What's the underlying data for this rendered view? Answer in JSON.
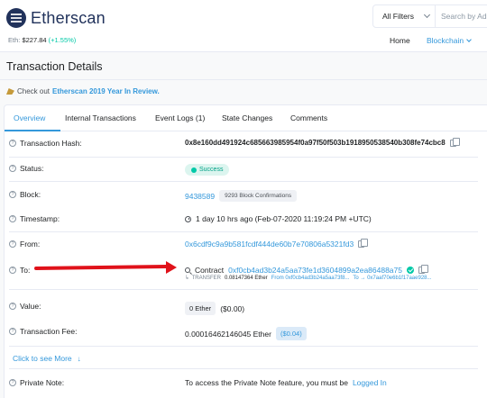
{
  "header": {
    "logo_text": "Etherscan",
    "eth_label": "Eth:",
    "eth_price": "$227.84",
    "eth_change": "(+1.55%)",
    "filter_label": "All Filters",
    "search_placeholder": "Search by Ad",
    "nav_home": "Home",
    "nav_blockchain": "Blockchain"
  },
  "page": {
    "title": "Transaction Details",
    "sponsor_prefix": "Check out",
    "sponsor_link": "Etherscan 2019 Year In Review."
  },
  "tabs": [
    "Overview",
    "Internal Transactions",
    "Event Logs (1)",
    "State Changes",
    "Comments"
  ],
  "rows": {
    "tx_hash": {
      "label": "Transaction Hash:",
      "value": "0x8e160dd491924c685663985954f0a97f50f503b1918950538540b308fe74cbc8"
    },
    "status": {
      "label": "Status:",
      "value": "Success"
    },
    "block": {
      "label": "Block:",
      "value": "9438589",
      "confirmations": "9293 Block Confirmations"
    },
    "timestamp": {
      "label": "Timestamp:",
      "value": "1 day 10 hrs ago (Feb-07-2020 11:19:24 PM +UTC)"
    },
    "from": {
      "label": "From:",
      "value": "0x6cdf9c9a9b581fcdf444de60b7e70806a5321fd3"
    },
    "to": {
      "label": "To:",
      "prefix": "Contract",
      "value": "0xf0cb4ad3b24a5aa73fe1d3604899a2ea86488a75"
    },
    "transfer": {
      "label": "TRANSFER",
      "amount": "0.08147364 Ether",
      "from_text": "From 0xf0cb4ad3b24a5aa73f8...",
      "to_text": "To → 0x7aaf70e6b1f17aae928..."
    },
    "value": {
      "label": "Value:",
      "amount": "0 Ether",
      "usd": "($0.00)"
    },
    "fee": {
      "label": "Transaction Fee:",
      "amount": "0.00016462146045 Ether",
      "usd": "($0.04)"
    },
    "see_more": "Click to see More",
    "note": {
      "label": "Private Note:",
      "text": "To access the Private Note feature, you must be",
      "link": "Logged In"
    }
  },
  "colors": {
    "accent": "#3498db",
    "success": "#00c9a7",
    "arrow": "#e0121a"
  }
}
